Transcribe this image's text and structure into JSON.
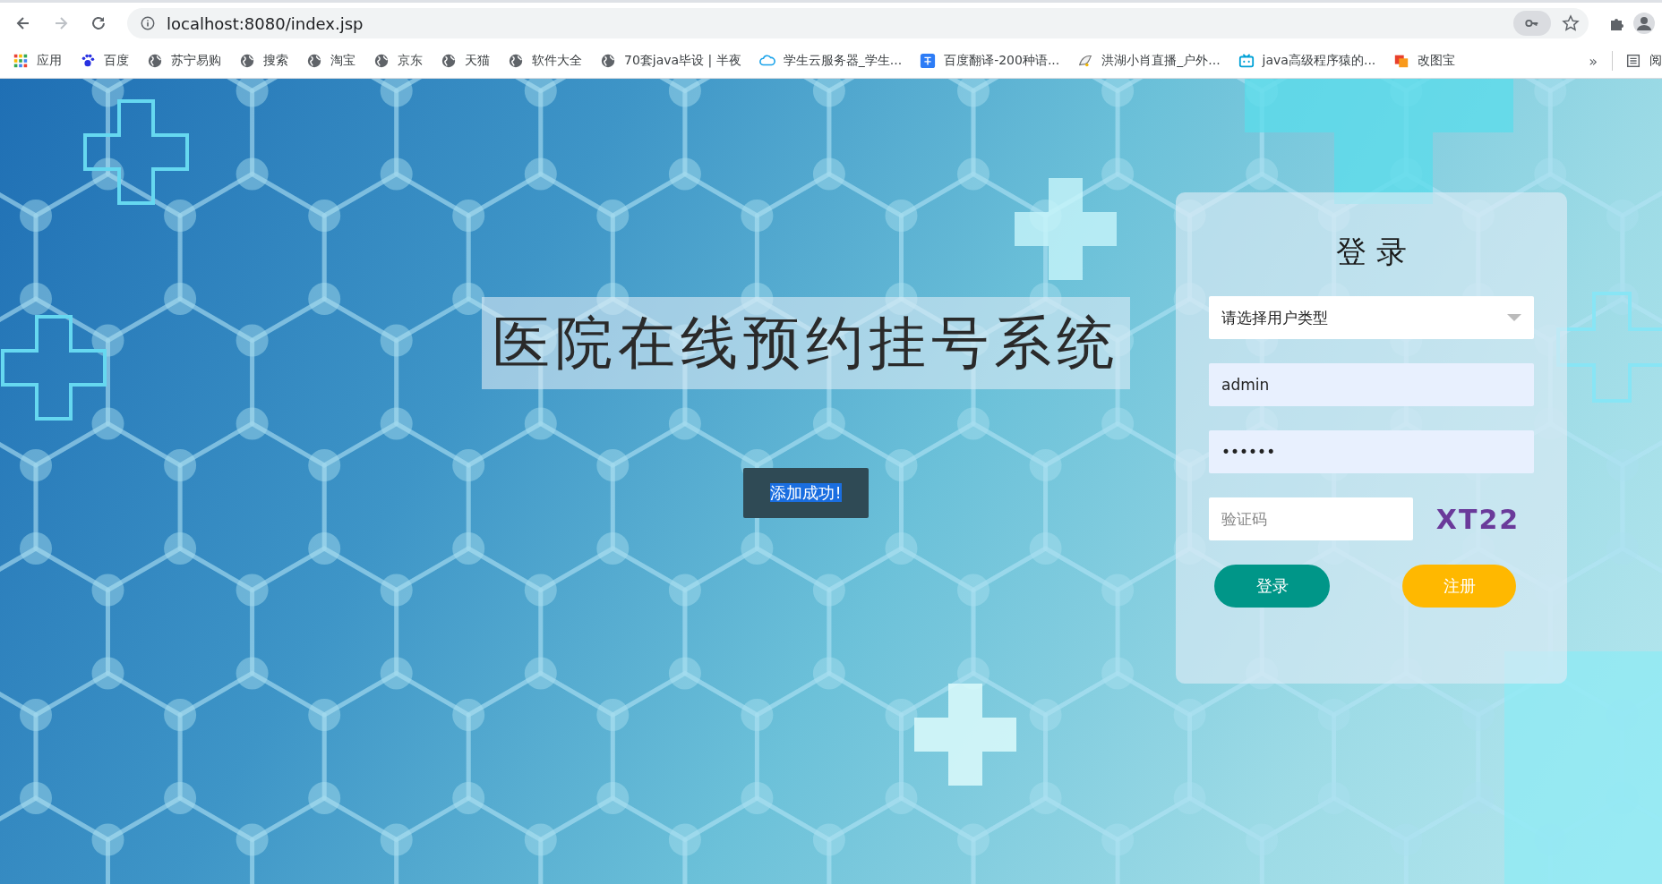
{
  "browser": {
    "url": "localhost:8080/index.jsp"
  },
  "bookmarks": [
    {
      "kind": "apps",
      "label": "应用"
    },
    {
      "kind": "paw",
      "label": "百度"
    },
    {
      "kind": "globe",
      "label": "苏宁易购"
    },
    {
      "kind": "globe",
      "label": "搜索"
    },
    {
      "kind": "globe",
      "label": "淘宝"
    },
    {
      "kind": "globe",
      "label": "京东"
    },
    {
      "kind": "globe",
      "label": "天猫"
    },
    {
      "kind": "globe",
      "label": "软件大全"
    },
    {
      "kind": "globe",
      "label": "70套java毕设 | 半夜"
    },
    {
      "kind": "cloud",
      "label": "学生云服务器_学生..."
    },
    {
      "kind": "translate",
      "label": "百度翻译-200种语..."
    },
    {
      "kind": "bird",
      "label": "洪湖小肖直播_户外..."
    },
    {
      "kind": "tv",
      "label": "java高级程序猿的..."
    },
    {
      "kind": "squares",
      "label": "改图宝"
    }
  ],
  "bookmarks_more": "»",
  "reading_list": {
    "label": "阅"
  },
  "page": {
    "title": "医院在线预约挂号系统",
    "toast": {
      "text": "添加成功!",
      "text_selected": true
    }
  },
  "login": {
    "title": "登 录",
    "user_type": {
      "value": "请选择用户类型"
    },
    "username": {
      "value": "admin"
    },
    "password": {
      "value": "••••••"
    },
    "captcha": {
      "placeholder": "验证码"
    },
    "captcha_image": "XT22",
    "buttons": [
      {
        "kind": "primary",
        "label": "登录"
      },
      {
        "kind": "warning",
        "label": "注册"
      }
    ]
  }
}
